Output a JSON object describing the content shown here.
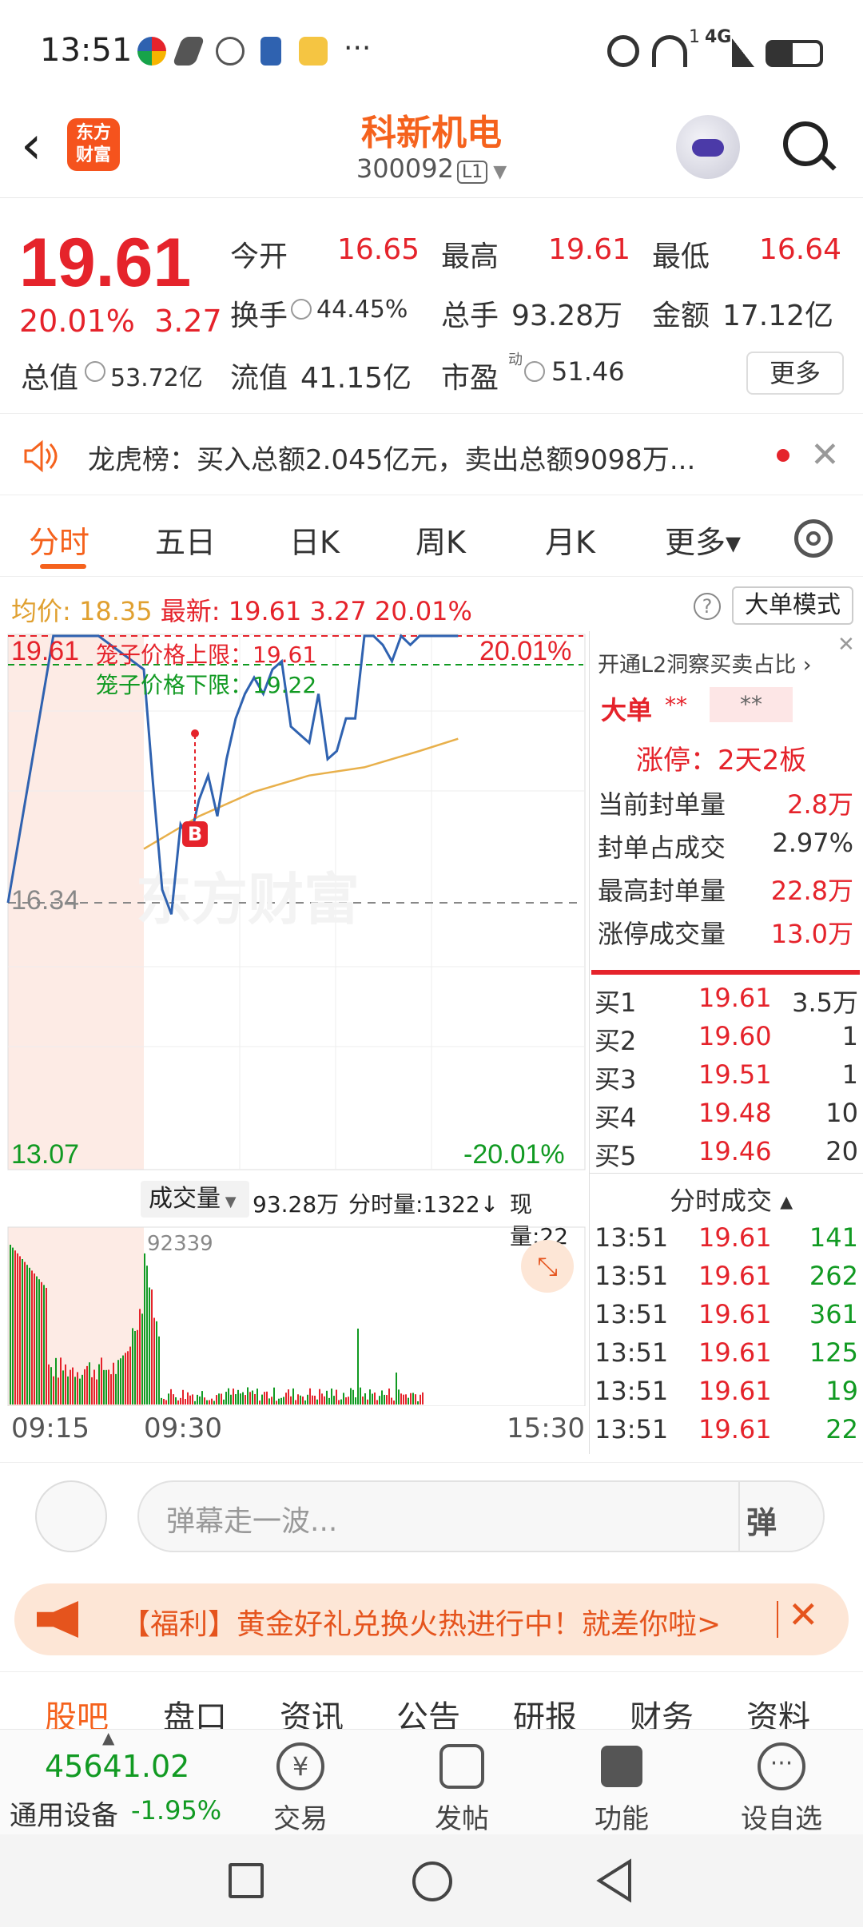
{
  "status_bar": {
    "time": "13:51",
    "signal": "4G",
    "sim": "1"
  },
  "header": {
    "back_icon": "chevron-left",
    "logo_text_top": "东方",
    "logo_text_bottom": "财富",
    "stock_name": "科新机电",
    "stock_code": "300092",
    "code_badge": "L1"
  },
  "quote": {
    "price": "19.61",
    "change_pct": "20.01%",
    "change_amt": "3.27",
    "fields": [
      {
        "label": "今开",
        "value": "16.65",
        "color": "red"
      },
      {
        "label": "最高",
        "value": "19.61",
        "color": "red"
      },
      {
        "label": "最低",
        "value": "16.64",
        "color": "red"
      },
      {
        "label": "换手",
        "value": "44.45%",
        "color": "dark"
      },
      {
        "label": "总手",
        "value": "93.28万",
        "color": "dark"
      },
      {
        "label": "金额",
        "value": "17.12亿",
        "color": "dark"
      },
      {
        "label": "总值",
        "value": "53.72亿",
        "color": "dark"
      },
      {
        "label": "流值",
        "value": "41.15亿",
        "color": "dark"
      },
      {
        "label": "市盈",
        "value": "51.46",
        "color": "dark"
      }
    ],
    "pe_superscript": "动",
    "more_label": "更多"
  },
  "news": {
    "text": "龙虎榜：买入总额2.045亿元，卖出总额9098万..."
  },
  "tabs": [
    {
      "label": "分时",
      "active": true
    },
    {
      "label": "五日",
      "active": false
    },
    {
      "label": "日K",
      "active": false
    },
    {
      "label": "周K",
      "active": false
    },
    {
      "label": "月K",
      "active": false
    },
    {
      "label": "更多▾",
      "active": false
    }
  ],
  "avg_row": {
    "avg_label": "均价:",
    "avg_value": "18.35",
    "latest_label": "最新:",
    "latest_value": "19.61",
    "chg": "3.27",
    "pct": "20.01%",
    "help": "?",
    "mode_button": "大单模式"
  },
  "chart": {
    "y_top": "19.61",
    "y_mid": "16.34",
    "y_bottom": "13.07",
    "pct_top": "20.01%",
    "pct_bottom": "-20.01%",
    "cage_upper": "笼子价格上限：19.61",
    "cage_lower": "笼子价格下限：19.22",
    "marker": "B",
    "watermark": "东方财富",
    "colors": {
      "price_line": "#2f62b0",
      "avg_line": "#e8b04b",
      "up": "#e5232b",
      "down": "#119a22"
    }
  },
  "chart_data": {
    "type": "line",
    "title": "",
    "xlabel": "",
    "ylabel": "",
    "x_ticks": [
      "09:15",
      "09:30",
      "15:30"
    ],
    "ylim": [
      13.07,
      19.61
    ],
    "reference": 16.34,
    "series": [
      {
        "name": "",
        "x": [
          "09:15",
          "09:20",
          "09:25",
          "09:30",
          "09:35",
          "09:40",
          "09:45",
          "09:50",
          "09:55",
          "10:00",
          "10:05",
          "10:10",
          "10:15",
          "10:20",
          "10:25",
          "10:30",
          "10:35",
          "10:40",
          "10:45",
          "10:50",
          "10:55",
          "11:00",
          "11:05",
          "11:10",
          "11:15",
          "11:20",
          "11:25",
          "11:30",
          "13:05",
          "13:10",
          "13:15",
          "13:20",
          "13:25",
          "13:30",
          "13:35",
          "13:40",
          "13:45",
          "13:51"
        ],
        "values": [
          16.34,
          19.61,
          19.61,
          19.2,
          17.8,
          16.5,
          16.2,
          17.3,
          17.1,
          17.6,
          17.9,
          17.4,
          18.1,
          18.6,
          18.9,
          19.1,
          18.9,
          19.2,
          19.3,
          18.5,
          18.4,
          18.3,
          18.9,
          18.1,
          18.2,
          18.6,
          18.6,
          19.61,
          19.61,
          19.5,
          19.3,
          19.61,
          19.5,
          19.61,
          19.61,
          19.61,
          19.61,
          19.61
        ]
      },
      {
        "name": "",
        "x": [
          "09:30",
          "10:00",
          "10:30",
          "11:00",
          "11:30",
          "13:30",
          "13:51"
        ],
        "values": [
          17.0,
          17.4,
          17.7,
          17.9,
          18.0,
          18.2,
          18.35
        ]
      }
    ]
  },
  "volume": {
    "selector": "成交量",
    "total": "93.28万",
    "period_vol": "分时量:1322↓",
    "current_vol": "现量:22",
    "peak_label": "92339",
    "x_ticks": [
      "09:15",
      "09:30",
      "15:30"
    ]
  },
  "right_panel": {
    "l2_link": "开通L2洞察买卖占比 ›",
    "big_order_label": "大单",
    "big_order_mask1": "**",
    "big_order_mask2": "**",
    "limit_status": "涨停：2天2板",
    "stats": [
      {
        "label": "当前封单量",
        "value": "2.8万"
      },
      {
        "label": "封单占成交",
        "value": "2.97%"
      },
      {
        "label": "最高封单量",
        "value": "22.8万"
      },
      {
        "label": "涨停成交量",
        "value": "13.0万"
      }
    ],
    "bids": [
      {
        "label": "买1",
        "price": "19.61",
        "vol": "3.5万"
      },
      {
        "label": "买2",
        "price": "19.60",
        "vol": "1"
      },
      {
        "label": "买3",
        "price": "19.51",
        "vol": "1"
      },
      {
        "label": "买4",
        "price": "19.48",
        "vol": "10"
      },
      {
        "label": "买5",
        "price": "19.46",
        "vol": "20"
      }
    ],
    "ticks_header": "分时成交 ▴",
    "ticks": [
      {
        "time": "13:51",
        "price": "19.61",
        "vol": "141"
      },
      {
        "time": "13:51",
        "price": "19.61",
        "vol": "262"
      },
      {
        "time": "13:51",
        "price": "19.61",
        "vol": "361"
      },
      {
        "time": "13:51",
        "price": "19.61",
        "vol": "125"
      },
      {
        "time": "13:51",
        "price": "19.61",
        "vol": "19"
      },
      {
        "time": "13:51",
        "price": "19.61",
        "vol": "22"
      }
    ]
  },
  "danmu": {
    "placeholder": "弹幕走一波...",
    "button": "弹"
  },
  "promo": {
    "text": "【福利】黄金好礼兑换火热进行中！就差你啦>"
  },
  "community_tabs": [
    {
      "label": "股吧",
      "active": true
    },
    {
      "label": "盘口",
      "active": false
    },
    {
      "label": "资讯",
      "active": false
    },
    {
      "label": "公告",
      "active": false
    },
    {
      "label": "研报",
      "active": false
    },
    {
      "label": "财务",
      "active": false
    },
    {
      "label": "资料",
      "active": false
    }
  ],
  "bottom_nav": {
    "index_value": "45641.02",
    "index_name": "通用设备",
    "index_change": "-1.95%",
    "items": [
      {
        "label": "交易",
        "icon": "yen-cycle-icon"
      },
      {
        "label": "发帖",
        "icon": "edit-icon"
      },
      {
        "label": "功能",
        "icon": "grid-icon"
      },
      {
        "label": "设自选",
        "icon": "more-circle-icon"
      }
    ]
  }
}
